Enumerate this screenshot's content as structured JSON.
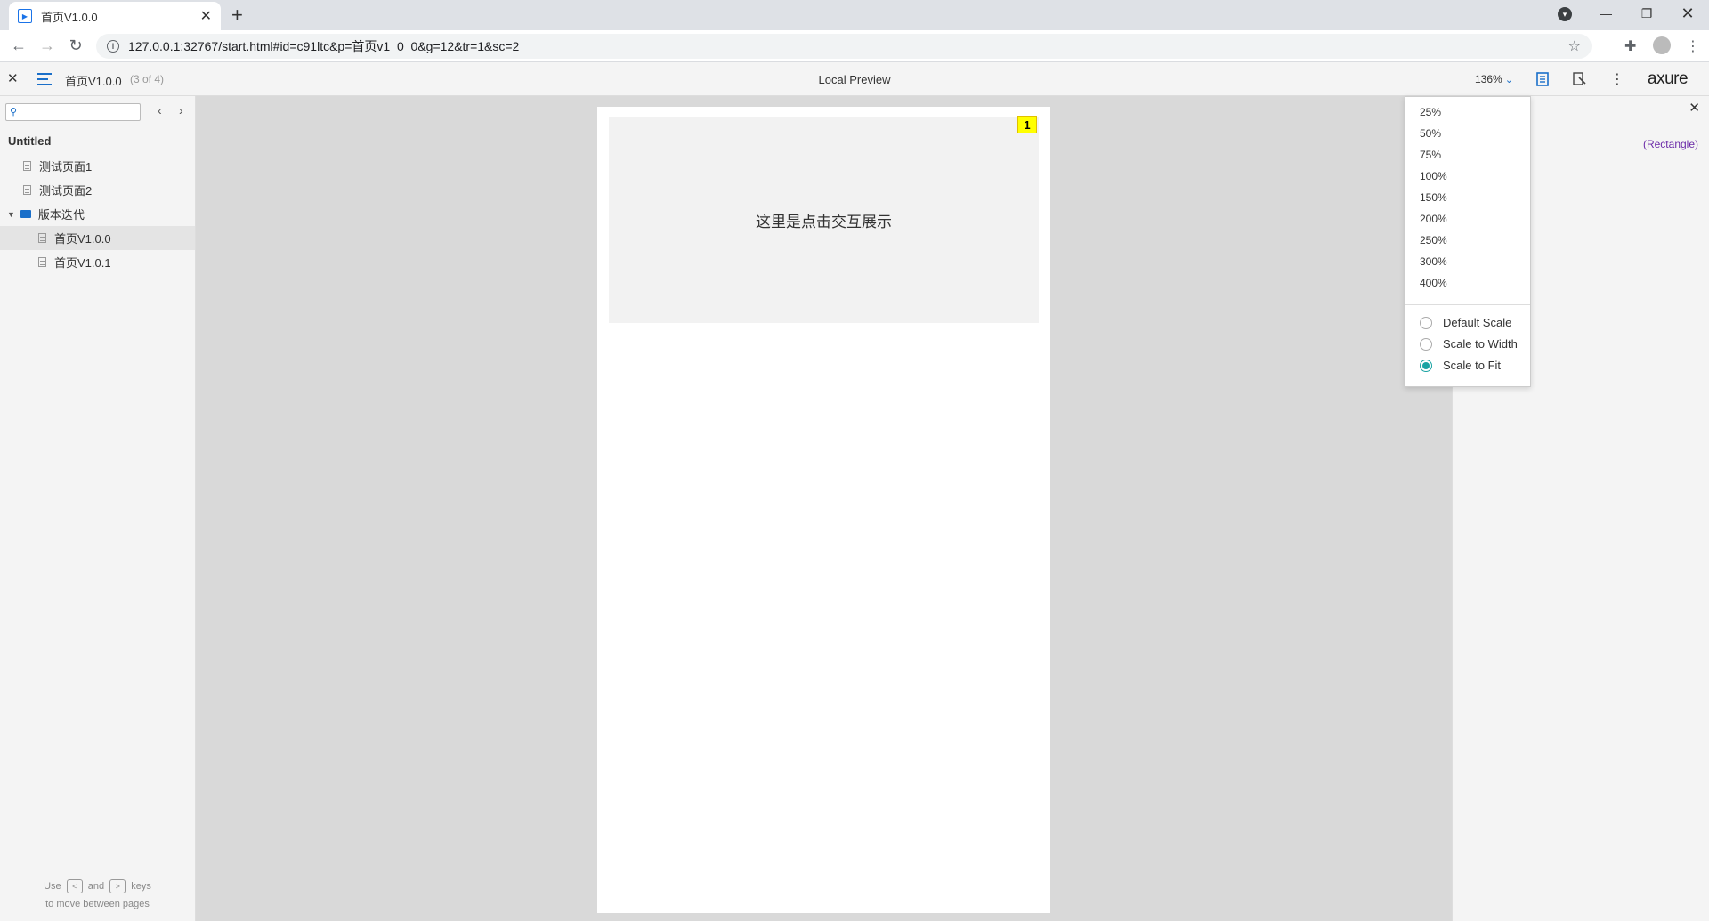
{
  "browser": {
    "tab_title": "首页V1.0.0",
    "new_tab_label": "+",
    "url": "127.0.0.1:32767/start.html#id=c91ltc&p=首页v1_0_0&g=12&tr=1&sc=2"
  },
  "toolbar": {
    "page_name": "首页V1.0.0",
    "page_count": "(3 of 4)",
    "center_title": "Local Preview",
    "zoom_value": "136%",
    "logo_text": "axure"
  },
  "sidebar": {
    "search_placeholder": "",
    "root": "Untitled",
    "items": [
      {
        "label": "测试页面1",
        "type": "page"
      },
      {
        "label": "测试页面2",
        "type": "page"
      },
      {
        "label": "版本迭代",
        "type": "folder"
      },
      {
        "label": "首页V1.0.0",
        "type": "page",
        "active": true
      },
      {
        "label": "首页V1.0.1",
        "type": "page"
      }
    ],
    "hint_use": "Use",
    "hint_and": "and",
    "hint_keys": "keys",
    "hint_line2": "to move between pages",
    "key_prev": "<",
    "key_next": ">"
  },
  "canvas": {
    "rect_text": "这里是点击交互展示",
    "footnote": "1"
  },
  "notes": {
    "widget_label": "(Rectangle)"
  },
  "zoom_menu": {
    "levels": [
      "25%",
      "50%",
      "75%",
      "100%",
      "150%",
      "200%",
      "250%",
      "300%",
      "400%"
    ],
    "options": [
      {
        "label": "Default Scale",
        "selected": false
      },
      {
        "label": "Scale to Width",
        "selected": false
      },
      {
        "label": "Scale to Fit",
        "selected": true
      }
    ]
  },
  "colors": {
    "accent": "#1a6fc9",
    "radio_selected": "#1aa3a3",
    "footnote_bg": "#ffff00",
    "widget_label": "#6b2aa8"
  }
}
